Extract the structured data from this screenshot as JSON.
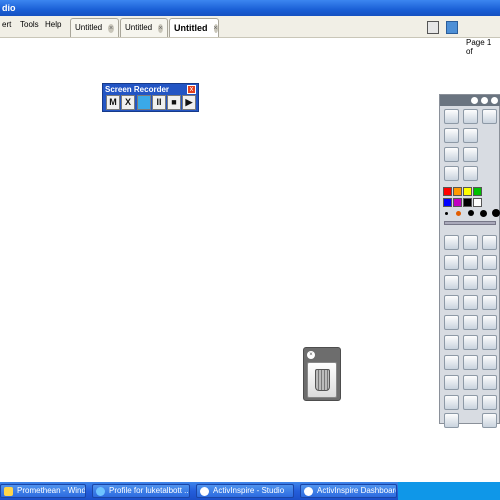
{
  "window": {
    "title": "dio"
  },
  "menu": [
    "ert",
    "Tools",
    "Help"
  ],
  "tabs": [
    {
      "label": "Untitled",
      "active": false
    },
    {
      "label": "Untitled",
      "active": false
    },
    {
      "label": "Untitled",
      "active": true
    }
  ],
  "toolbar_right": {
    "page_label": "Page 1 of"
  },
  "recorder": {
    "title": "Screen Recorder",
    "close": "x",
    "buttons": [
      "M",
      "X",
      "",
      "II",
      "■",
      "▶"
    ]
  },
  "taskbar": {
    "items": [
      {
        "label": "Promethean - Windo..."
      },
      {
        "label": "Profile for luketalbott ..."
      },
      {
        "label": "ActivInspire - Studio"
      },
      {
        "label": "ActivInspire Dashboard"
      }
    ]
  },
  "colors": {
    "titlebar": "#1a5fd6",
    "recorder": "#2355c4",
    "taskbar": "#245edb",
    "palette": [
      "#ff0000",
      "#ff9900",
      "#ffff00",
      "#00c000",
      "#0000ff",
      "#c000c0",
      "#000000",
      "#ffffff"
    ]
  }
}
